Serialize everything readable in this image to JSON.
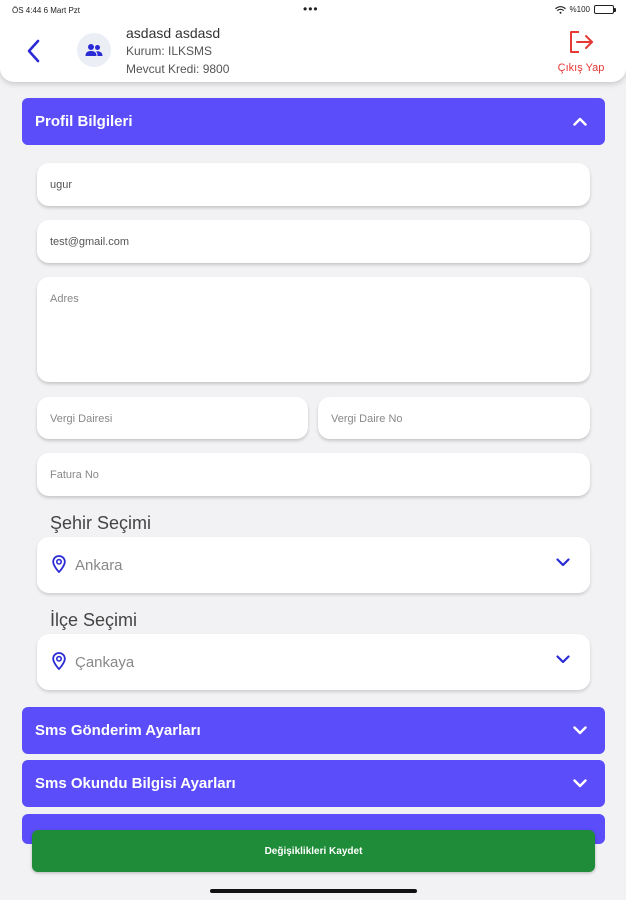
{
  "status_bar": {
    "time": "ÖS 4:44   6 Mart Pzt",
    "dots": "•••",
    "battery": "%100"
  },
  "header": {
    "user_name": "asdasd asdasd",
    "institution": "Kurum: ILKSMS",
    "credit": "Mevcut Kredi: 9800",
    "logout_label": "Çıkış Yap",
    "accent_color": "#2b2bd6",
    "logout_color": "#e53935"
  },
  "profile_section": {
    "title": "Profil Bilgileri",
    "expanded": true,
    "fields": {
      "name_value": "ugur",
      "email_value": "test@gmail.com",
      "address_placeholder": "Adres",
      "tax_office_placeholder": "Vergi Dairesi",
      "tax_number_placeholder": "Vergi Daire No",
      "invoice_placeholder": "Fatura No"
    },
    "city_label": "Şehir Seçimi",
    "city_value": "Ankara",
    "district_label": "İlçe Seçimi",
    "district_value": "Çankaya"
  },
  "sections": [
    {
      "title": "Sms Gönderim Ayarları"
    },
    {
      "title": "Sms Okundu Bilgisi Ayarları"
    }
  ],
  "save_button": "Değişiklikleri Kaydet",
  "colors": {
    "accordion": "#5b4dfa",
    "save": "#1e8c38",
    "background": "#f2f2f4"
  }
}
